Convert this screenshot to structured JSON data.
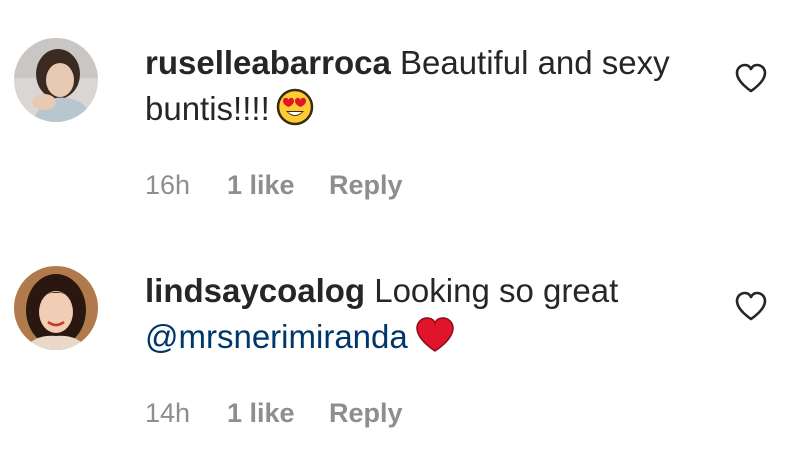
{
  "comments": [
    {
      "username": "ruselleabarroca",
      "text": " Beautiful and sexy buntis!!!!",
      "emoji": "heart-eyes-emoji",
      "time": "16h",
      "likes": "1 like",
      "reply_label": "Reply",
      "like_icon": "heart-outline-icon"
    },
    {
      "username": "lindsaycoalog",
      "text": " Looking so great ",
      "mention": "@mrsnerimiranda",
      "emoji": "red-heart-emoji",
      "time": "14h",
      "likes": "1 like",
      "reply_label": "Reply",
      "like_icon": "heart-outline-icon"
    }
  ],
  "colors": {
    "text": "#262626",
    "meta": "#8e8e8e",
    "mention": "#00376b",
    "red_heart": "#e0142b",
    "emoji_face": "#ffcc33"
  }
}
